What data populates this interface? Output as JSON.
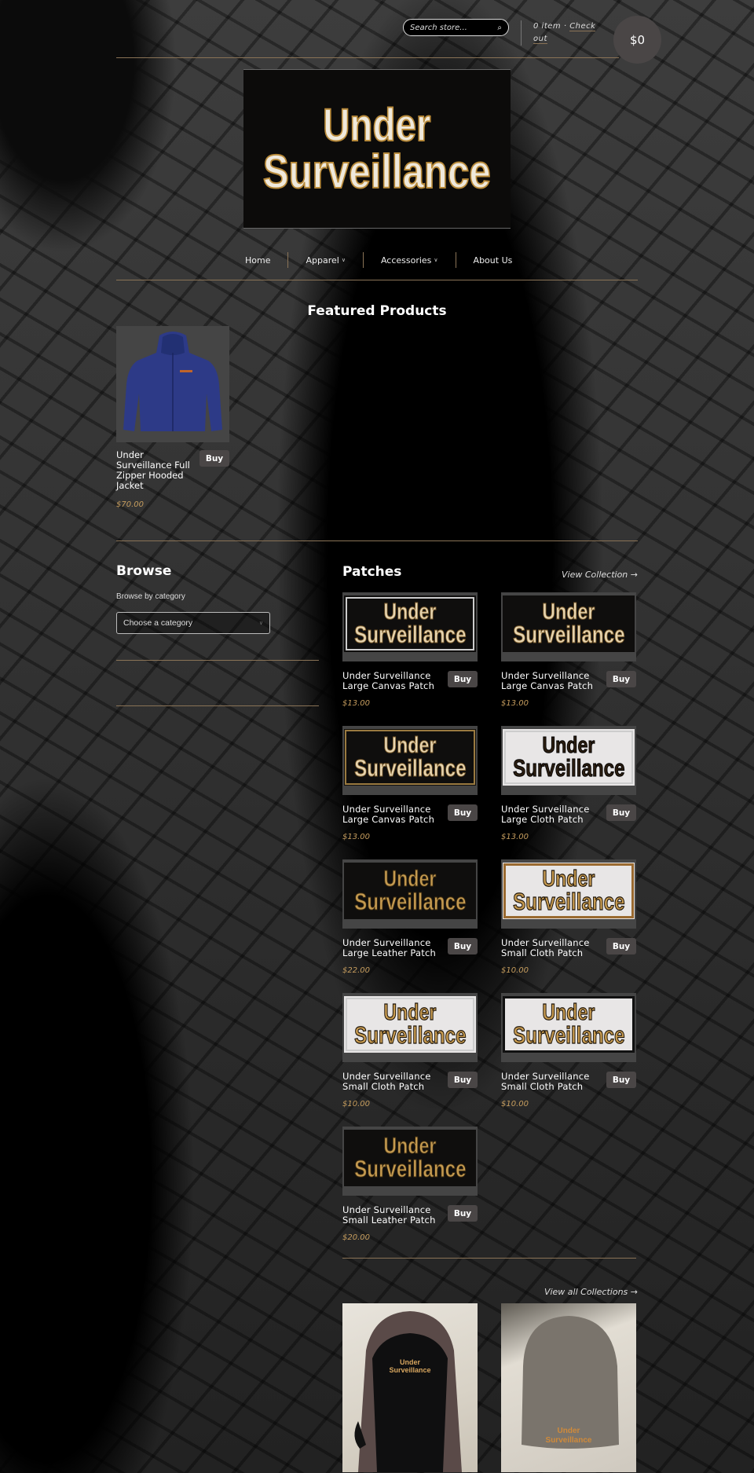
{
  "header": {
    "search_placeholder": "Search store...",
    "search_icon": "search-icon",
    "cart_count_text": "0 item",
    "cart_separator": "·",
    "checkout_label": "Check out",
    "cart_total": "$0"
  },
  "logo": {
    "line1": "Under",
    "line2": "Surveillance"
  },
  "nav": {
    "items": [
      {
        "label": "Home",
        "has_dropdown": false
      },
      {
        "label": "Apparel",
        "has_dropdown": true
      },
      {
        "label": "Accessories",
        "has_dropdown": true
      },
      {
        "label": "About Us",
        "has_dropdown": false
      }
    ],
    "dropdown_glyph": "⌄"
  },
  "featured": {
    "title": "Featured Products",
    "products": [
      {
        "name": "Under Surveillance Full Zipper Hooded Jacket",
        "price": "$70.00",
        "buy_label": "Buy"
      }
    ]
  },
  "browse": {
    "title": "Browse",
    "label": "Browse by category",
    "select_value": "Choose a category"
  },
  "patches": {
    "title": "Patches",
    "view_collection_label": "View Collection →",
    "patch_text_line1": "Under",
    "patch_text_line2": "Surveillance",
    "products": [
      {
        "name": "Under Surveillance Large Canvas Patch",
        "price": "$13.00",
        "buy_label": "Buy"
      },
      {
        "name": "Under Surveillance Large Canvas Patch",
        "price": "$13.00",
        "buy_label": "Buy"
      },
      {
        "name": "Under Surveillance Large Canvas Patch",
        "price": "$13.00",
        "buy_label": "Buy"
      },
      {
        "name": "Under Surveillance Large Cloth Patch",
        "price": "$13.00",
        "buy_label": "Buy"
      },
      {
        "name": "Under Surveillance Large Leather Patch",
        "price": "$22.00",
        "buy_label": "Buy"
      },
      {
        "name": "Under Surveillance Small Cloth Patch",
        "price": "$10.00",
        "buy_label": "Buy"
      },
      {
        "name": "Under Surveillance Small Cloth Patch",
        "price": "$10.00",
        "buy_label": "Buy"
      },
      {
        "name": "Under Surveillance Small Cloth Patch",
        "price": "$10.00",
        "buy_label": "Buy"
      },
      {
        "name": "Under Surveillance Small Leather Patch",
        "price": "$20.00",
        "buy_label": "Buy"
      }
    ]
  },
  "collections": {
    "view_all_label": "View all Collections →",
    "embroidery_line1": "Under",
    "embroidery_line2": "Surveillance"
  },
  "colors": {
    "accent_gold": "#8a7356",
    "price_gold": "#c69d5e",
    "button_bg": "#4a4646"
  }
}
